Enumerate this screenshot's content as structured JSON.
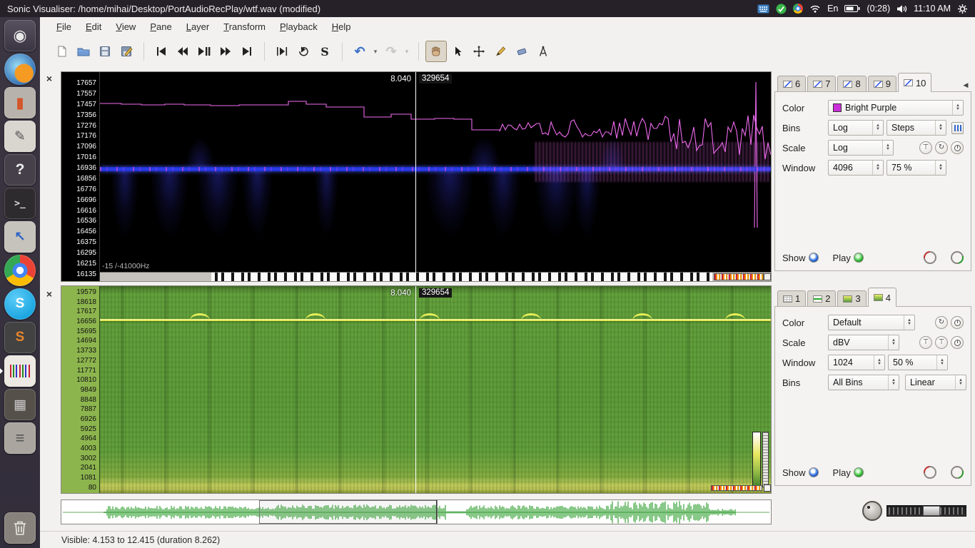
{
  "topbar": {
    "title": "Sonic Visualiser: /home/mihai/Desktop/PortAudioRecPlay/wtf.wav (modified)",
    "language": "En",
    "battery": "(0:28)",
    "clock": "11:10 AM"
  },
  "launcher": {
    "items": [
      {
        "name": "dash-home-icon",
        "cls": "dash",
        "glyph": "◉"
      },
      {
        "name": "firefox-icon",
        "cls": "firefox",
        "glyph": ""
      },
      {
        "name": "media-player-icon",
        "cls": "media",
        "glyph": "▮"
      },
      {
        "name": "text-editor-icon",
        "cls": "editor",
        "glyph": "✎"
      },
      {
        "name": "help-icon",
        "cls": "help",
        "glyph": "?"
      },
      {
        "name": "terminal-icon",
        "cls": "terminal",
        "glyph": ">_"
      },
      {
        "name": "pointer-tool-icon",
        "cls": "pointer",
        "glyph": "↖"
      },
      {
        "name": "chrome-icon",
        "cls": "chrome",
        "glyph": ""
      },
      {
        "name": "skype-icon",
        "cls": "skype",
        "glyph": "S"
      },
      {
        "name": "sublime-text-icon",
        "cls": "sublime",
        "glyph": "S"
      },
      {
        "name": "sonic-visualiser-icon",
        "cls": "sonic",
        "glyph": ""
      },
      {
        "name": "dark-app-icon",
        "cls": "darkapp",
        "glyph": "▦"
      },
      {
        "name": "archive-app-icon",
        "cls": "archive",
        "glyph": "≡"
      }
    ]
  },
  "menubar": {
    "items": [
      "File",
      "Edit",
      "View",
      "Pane",
      "Layer",
      "Transform",
      "Playback",
      "Help"
    ]
  },
  "toolbar": {
    "buttons": [
      "new-file",
      "open-file",
      "save",
      "save-as",
      "rewind-to-start",
      "rewind",
      "play-pause",
      "fast-forward",
      "fast-forward-to-end",
      "play-selection",
      "loop-playback",
      "solo",
      "undo",
      "redo",
      "navigate-tool",
      "select-tool",
      "edit-tool",
      "draw-tool",
      "erase-tool",
      "measure-tool"
    ],
    "active_tool": "navigate-tool"
  },
  "pane1": {
    "cursor_time": "8.040",
    "cursor_frame": "329654",
    "corner_label": "-15 /-41000Hz",
    "freq_labels": [
      "17657",
      "17557",
      "17457",
      "17356",
      "17276",
      "17176",
      "17096",
      "17016",
      "16936",
      "16856",
      "16776",
      "16696",
      "16616",
      "16536",
      "16456",
      "16375",
      "16295",
      "16215",
      "16135"
    ],
    "tabs": [
      {
        "label": "6",
        "icon": "chart"
      },
      {
        "label": "7",
        "icon": "chart"
      },
      {
        "label": "8",
        "icon": "chart"
      },
      {
        "label": "9",
        "icon": "chart"
      },
      {
        "label": "10",
        "icon": "chart",
        "active": true
      }
    ],
    "props": {
      "color_label": "Color",
      "color_value": "Bright Purple",
      "bins_label": "Bins",
      "bins_value": "Log",
      "bins_style": "Steps",
      "scale_label": "Scale",
      "scale_value": "Log",
      "window_label": "Window",
      "window_size": "4096",
      "window_overlap": "75 %",
      "show_label": "Show",
      "play_label": "Play"
    }
  },
  "pane2": {
    "cursor_time": "8.040",
    "cursor_frame": "329654",
    "freq_labels": [
      "19579",
      "18618",
      "17617",
      "16656",
      "15695",
      "14694",
      "13733",
      "12772",
      "11771",
      "10810",
      "9849",
      "8848",
      "7887",
      "6926",
      "5925",
      "4964",
      "4003",
      "3002",
      "2041",
      "1081",
      "80"
    ],
    "tabs": [
      {
        "label": "1",
        "icon": "table"
      },
      {
        "label": "2",
        "icon": "wave"
      },
      {
        "label": "3",
        "icon": "spect"
      },
      {
        "label": "4",
        "icon": "spect",
        "active": true
      }
    ],
    "props": {
      "color_label": "Color",
      "color_value": "Default",
      "scale_label": "Scale",
      "scale_value": "dBV",
      "window_label": "Window",
      "window_size": "1024",
      "window_overlap": "50 %",
      "bins_label": "Bins",
      "bins_value": "All Bins",
      "bins_scale": "Linear",
      "show_label": "Show",
      "play_label": "Play"
    }
  },
  "statusbar": {
    "text": "Visible: 4.153 to 12.415 (duration 8.262)"
  }
}
